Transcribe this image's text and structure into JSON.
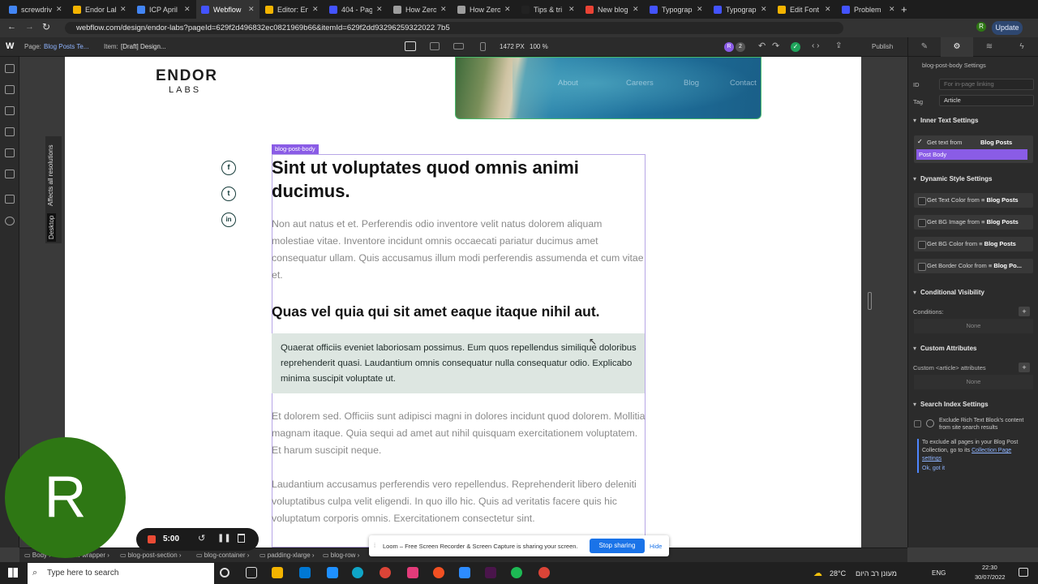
{
  "browser": {
    "tabs": [
      {
        "title": "screwdriv",
        "color": "#4285f4"
      },
      {
        "title": "Endor Lab",
        "color": "#f4b400"
      },
      {
        "title": "ICP April",
        "color": "#4285f4"
      },
      {
        "title": "Webflow",
        "color": "#4353ff",
        "active": true
      },
      {
        "title": "Editor: En",
        "color": "#f4b400"
      },
      {
        "title": "404 - Pag",
        "color": "#4353ff"
      },
      {
        "title": "How Zero",
        "color": "#9e9e9e"
      },
      {
        "title": "How Zero",
        "color": "#9e9e9e"
      },
      {
        "title": "Tips & tri",
        "color": "#222222"
      },
      {
        "title": "New blog",
        "color": "#ea4335"
      },
      {
        "title": "Typograp",
        "color": "#4353ff"
      },
      {
        "title": "Typograp",
        "color": "#4353ff"
      },
      {
        "title": "Edit Font",
        "color": "#f4b400"
      },
      {
        "title": "Problem",
        "color": "#4353ff"
      }
    ],
    "new_tab": "+",
    "url": "webflow.com/design/endor-labs?pageId=629f2d496832ec0821969b66&itemId=629f2dd93296259322022 7b5",
    "profile": "R",
    "update_label": "Update"
  },
  "webflow": {
    "logo": "W",
    "page_label": "Page:",
    "page_value": "Blog Posts Te...",
    "item_label": "Item:",
    "item_value": "[Draft] Design...",
    "width_readout": "1472 PX",
    "zoom_readout": "100 %",
    "collab_initial": "R",
    "collab_count": "2",
    "publish_label": "Publish",
    "breakpoint_note": "Affects all resolutions",
    "breakpoint_name": "Desktop"
  },
  "canvas": {
    "logo_top": "ENDOR",
    "logo_bottom": "LABS",
    "hero_nav": [
      "About",
      "Careers",
      "Blog",
      "Contact"
    ],
    "social": [
      "f",
      "t",
      "in"
    ],
    "selection_badge": "blog-post-body",
    "heading1": "Sint ut voluptates quod omnis animi ducimus.",
    "para1": "Non aut natus et et. Perferendis odio inventore velit natus dolorem aliquam molestiae vitae. Inventore incidunt omnis occaecati pariatur ducimus amet consequatur ullam. Quis accusamus illum modi perferendis assumenda et cum vitae et.",
    "heading2": "Quas vel quia qui sit amet eaque itaque nihil aut.",
    "quote": "Quaerat officiis eveniet laboriosam possimus. Eum quos repellendus similique doloribus reprehenderit quasi. Laudantium omnis consequatur nulla consequatur odio. Explicabo minima suscipit voluptate ut.",
    "para2": "Et dolorem sed. Officiis sunt adipisci magni in dolores incidunt quod dolorem. Mollitia magnam itaque. Quia sequi ad amet aut nihil quisquam exercitationem voluptatem. Et harum suscipit neque.",
    "para3": "Laudantium accusamus perferendis vero repellendus. Reprehenderit libero deleniti voluptatibus culpa velit eligendi. In quo illo hic. Quis ad veritatis facere quis hic voluptatum corporis omnis. Exercitationem consectetur sint."
  },
  "panel": {
    "title": "blog-post-body Settings",
    "id_label": "ID",
    "id_placeholder": "For in-page linking",
    "tag_label": "Tag",
    "tag_value": "Article",
    "inner_text_title": "Inner Text Settings",
    "get_text_prefix": "Get text from",
    "collection": "Blog Posts",
    "field_value": "Post Body",
    "dynamic_title": "Dynamic Style Settings",
    "dynamic_rows": [
      {
        "text": "Get Text Color from",
        "source": "Blog Posts"
      },
      {
        "text": "Get BG Image from",
        "source": "Blog Posts"
      },
      {
        "text": "Get BG Color from",
        "source": "Blog Posts"
      },
      {
        "text": "Get Border Color from",
        "source": "Blog Po..."
      }
    ],
    "visibility_title": "Conditional Visibility",
    "conditions_label": "Conditions:",
    "conditions_value": "None",
    "custom_attr_title": "Custom Attributes",
    "custom_attr_label": "Custom <article> attributes",
    "custom_attr_value": "None",
    "search_title": "Search Index Settings",
    "exclude_text": "Exclude Rich Text Block's content from site search results",
    "info_text": "To exclude all pages in your Blog Post Collection, go to its",
    "info_link": "Collection Page settings",
    "ok_link": "Ok, got it"
  },
  "breadcrumbs": [
    "Body",
    "m-wrapper",
    "blog-post-section",
    "blog-container",
    "padding-xlarge",
    "blog-row"
  ],
  "loom": {
    "timer": "5:00",
    "share_text": "Loom – Free Screen Recorder & Screen Capture is sharing your screen.",
    "stop_label": "Stop sharing",
    "hide_label": "Hide",
    "avatar_letter": "R"
  },
  "taskbar": {
    "search_placeholder": "Type here to search",
    "temperature": "28°C",
    "weather": "מעונן רב היום",
    "lang": "ENG",
    "time": "22:30",
    "date": "30/07/2022"
  }
}
